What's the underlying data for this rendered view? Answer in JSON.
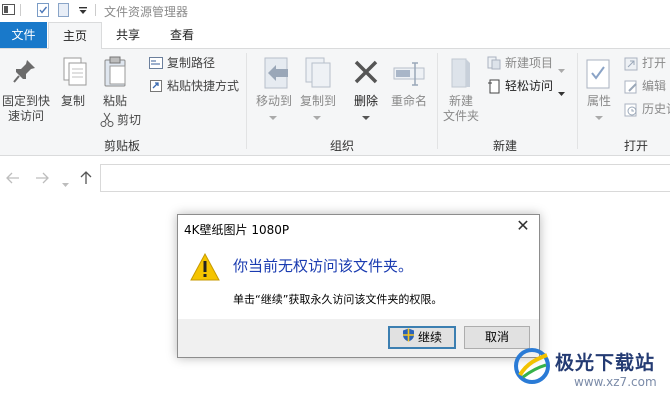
{
  "window": {
    "title": "文件资源管理器"
  },
  "tabs": {
    "file": "文件",
    "home": "主页",
    "share": "共享",
    "view": "查看"
  },
  "ribbon": {
    "clipboard": {
      "pin_label_1": "固定到快",
      "pin_label_2": "速访问",
      "copy": "复制",
      "paste": "粘贴",
      "copy_path": "复制路径",
      "paste_shortcut": "粘贴快捷方式",
      "cut": "剪切",
      "group_label": "剪贴板"
    },
    "organize": {
      "move_to": "移动到",
      "copy_to": "复制到",
      "delete": "删除",
      "rename": "重命名",
      "group_label": "组织"
    },
    "new": {
      "new_folder_1": "新建",
      "new_folder_2": "文件夹",
      "new_item": "新建项目",
      "easy_access": "轻松访问",
      "group_label": "新建"
    },
    "open": {
      "properties": "属性",
      "open": "打开",
      "edit": "编辑",
      "history": "历史记",
      "group_label": "打开"
    }
  },
  "dialog": {
    "title": "4K壁纸图片 1080P",
    "heading": "你当前无权访问该文件夹。",
    "message": "单击“继续”获取永久访问该文件夹的权限。",
    "continue_label": "继续",
    "cancel_label": "取消"
  },
  "watermark": {
    "name": "极光下载站",
    "url": "www.xz7.com"
  },
  "colors": {
    "accent": "#1979ca",
    "heading": "#1a3bb0",
    "warning": "#f5c400"
  }
}
